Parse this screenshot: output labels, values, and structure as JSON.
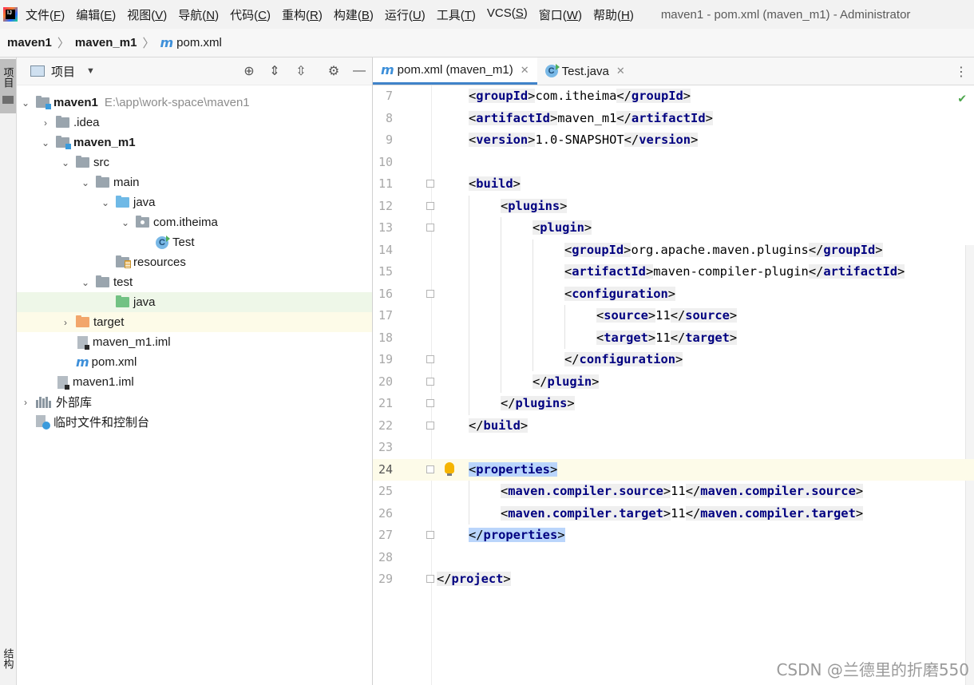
{
  "menubar": {
    "items": [
      {
        "label": "文件",
        "key": "F"
      },
      {
        "label": "编辑",
        "key": "E"
      },
      {
        "label": "视图",
        "key": "V"
      },
      {
        "label": "导航",
        "key": "N"
      },
      {
        "label": "代码",
        "key": "C"
      },
      {
        "label": "重构",
        "key": "R"
      },
      {
        "label": "构建",
        "key": "B"
      },
      {
        "label": "运行",
        "key": "U"
      },
      {
        "label": "工具",
        "key": "T"
      },
      {
        "label": "VCS",
        "key": "S"
      },
      {
        "label": "窗口",
        "key": "W"
      },
      {
        "label": "帮助",
        "key": "H"
      }
    ],
    "window_title": "maven1 - pom.xml (maven_m1) - Administrator",
    "logo_text": "IJ"
  },
  "breadcrumb": {
    "items": [
      "maven1",
      "maven_m1"
    ],
    "file": "pom.xml",
    "file_icon": "m"
  },
  "left_strip": {
    "project_tab": "项目",
    "structure_tab": "结构"
  },
  "project_panel": {
    "title": "项目",
    "tree": [
      {
        "label": "maven1",
        "path": "E:\\app\\work-space\\maven1",
        "bold": true
      },
      {
        "label": ".idea"
      },
      {
        "label": "maven_m1",
        "bold": true
      },
      {
        "label": "src"
      },
      {
        "label": "main"
      },
      {
        "label": "java"
      },
      {
        "label": "com.itheima"
      },
      {
        "label": "Test"
      },
      {
        "label": "resources"
      },
      {
        "label": "test"
      },
      {
        "label": "java"
      },
      {
        "label": "target"
      },
      {
        "label": "maven_m1.iml"
      },
      {
        "label": "pom.xml"
      },
      {
        "label": "maven1.iml"
      },
      {
        "label": "外部库"
      },
      {
        "label": "临时文件和控制台"
      }
    ]
  },
  "editor": {
    "tabs": [
      {
        "label": "pom.xml (maven_m1)",
        "icon": "m"
      },
      {
        "label": "Test.java",
        "icon": "C"
      }
    ],
    "lines": [
      {
        "n": "7",
        "open": "groupId",
        "text": "com.itheima",
        "close": "groupId"
      },
      {
        "n": "8",
        "open": "artifactId",
        "text": "maven_m1",
        "close": "artifactId"
      },
      {
        "n": "9",
        "open": "version",
        "text": "1.0-SNAPSHOT",
        "close": "version"
      },
      {
        "n": "10"
      },
      {
        "n": "11",
        "open": "build"
      },
      {
        "n": "12",
        "open": "plugins"
      },
      {
        "n": "13",
        "open": "plugin"
      },
      {
        "n": "14",
        "open": "groupId",
        "text": "org.apache.maven.plugins",
        "close": "groupId"
      },
      {
        "n": "15",
        "open": "artifactId",
        "text": "maven-compiler-plugin",
        "close": "artifactId"
      },
      {
        "n": "16",
        "open": "configuration"
      },
      {
        "n": "17",
        "open": "source",
        "text": "11",
        "close": "source"
      },
      {
        "n": "18",
        "open": "target",
        "text": "11",
        "close": "target"
      },
      {
        "n": "19",
        "close": "configuration"
      },
      {
        "n": "20",
        "close": "plugin"
      },
      {
        "n": "21",
        "close": "plugins"
      },
      {
        "n": "22",
        "close": "build"
      },
      {
        "n": "23"
      },
      {
        "n": "24",
        "open": "properties"
      },
      {
        "n": "25",
        "open": "maven.compiler.source",
        "text": "11",
        "close": "maven.compiler.source"
      },
      {
        "n": "26",
        "open": "maven.compiler.target",
        "text": "11",
        "close": "maven.compiler.target"
      },
      {
        "n": "27",
        "close": "properties"
      },
      {
        "n": "28"
      },
      {
        "n": "29",
        "close": "project"
      }
    ]
  },
  "watermark": "CSDN @兰德里的折磨550",
  "colors": {
    "tag": "#000080",
    "highlight": "#bad5fb",
    "current_line": "#fdfbe9",
    "selected_row": "#eef7e8",
    "accent": "#4083c9"
  }
}
